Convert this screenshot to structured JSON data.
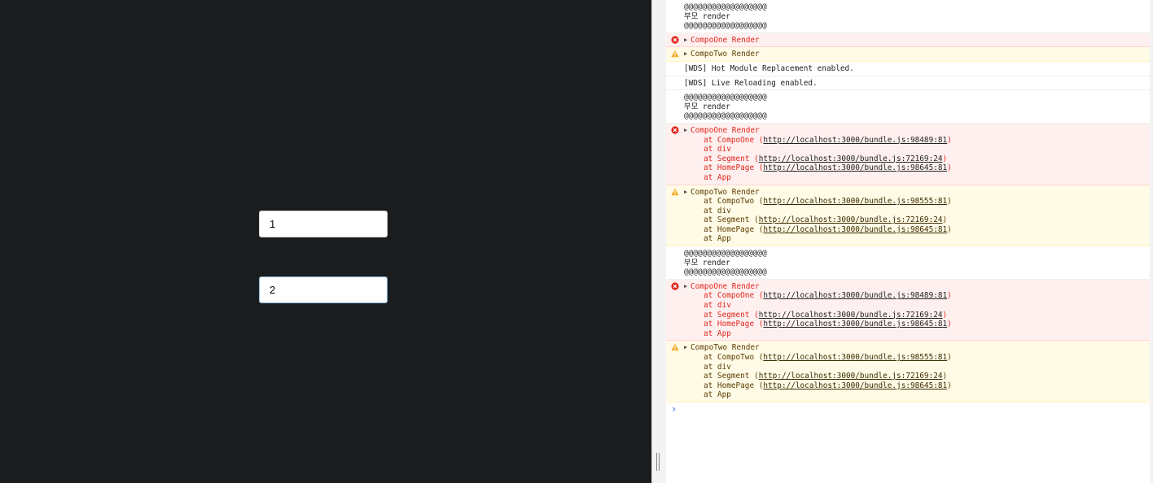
{
  "app": {
    "input1_value": "1",
    "input2_value": "2"
  },
  "console": {
    "rows": [
      {
        "kind": "log",
        "lines": [
          "@@@@@@@@@@@@@@@@@@",
          "부모 render",
          "@@@@@@@@@@@@@@@@@@"
        ]
      },
      {
        "kind": "error",
        "head": "CompoOne Render"
      },
      {
        "kind": "warn",
        "head": "CompoTwo Render"
      },
      {
        "kind": "log",
        "lines": [
          "[WDS] Hot Module Replacement enabled."
        ]
      },
      {
        "kind": "log",
        "lines": [
          "[WDS] Live Reloading enabled."
        ]
      },
      {
        "kind": "log",
        "lines": [
          "@@@@@@@@@@@@@@@@@@",
          "부모 render",
          "@@@@@@@@@@@@@@@@@@"
        ]
      },
      {
        "kind": "error",
        "head": "CompoOne Render",
        "stack": [
          {
            "pre": "at CompoOne (",
            "link": "http://localhost:3000/bundle.js:98489:81",
            "post": ")"
          },
          {
            "pre": "at div",
            "link": "",
            "post": ""
          },
          {
            "pre": "at Segment (",
            "link": "http://localhost:3000/bundle.js:72169:24",
            "post": ")"
          },
          {
            "pre": "at HomePage (",
            "link": "http://localhost:3000/bundle.js:98645:81",
            "post": ")"
          },
          {
            "pre": "at App",
            "link": "",
            "post": ""
          }
        ]
      },
      {
        "kind": "warn",
        "head": "CompoTwo Render",
        "stack": [
          {
            "pre": "at CompoTwo (",
            "link": "http://localhost:3000/bundle.js:98555:81",
            "post": ")"
          },
          {
            "pre": "at div",
            "link": "",
            "post": ""
          },
          {
            "pre": "at Segment (",
            "link": "http://localhost:3000/bundle.js:72169:24",
            "post": ")"
          },
          {
            "pre": "at HomePage (",
            "link": "http://localhost:3000/bundle.js:98645:81",
            "post": ")"
          },
          {
            "pre": "at App",
            "link": "",
            "post": ""
          }
        ]
      },
      {
        "kind": "log",
        "lines": [
          "@@@@@@@@@@@@@@@@@@",
          "부모 render",
          "@@@@@@@@@@@@@@@@@@"
        ]
      },
      {
        "kind": "error",
        "head": "CompoOne Render",
        "stack": [
          {
            "pre": "at CompoOne (",
            "link": "http://localhost:3000/bundle.js:98489:81",
            "post": ")"
          },
          {
            "pre": "at div",
            "link": "",
            "post": ""
          },
          {
            "pre": "at Segment (",
            "link": "http://localhost:3000/bundle.js:72169:24",
            "post": ")"
          },
          {
            "pre": "at HomePage (",
            "link": "http://localhost:3000/bundle.js:98645:81",
            "post": ")"
          },
          {
            "pre": "at App",
            "link": "",
            "post": ""
          }
        ]
      },
      {
        "kind": "warn",
        "head": "CompoTwo Render",
        "stack": [
          {
            "pre": "at CompoTwo (",
            "link": "http://localhost:3000/bundle.js:98555:81",
            "post": ")"
          },
          {
            "pre": "at div",
            "link": "",
            "post": ""
          },
          {
            "pre": "at Segment (",
            "link": "http://localhost:3000/bundle.js:72169:24",
            "post": ")"
          },
          {
            "pre": "at HomePage (",
            "link": "http://localhost:3000/bundle.js:98645:81",
            "post": ")"
          },
          {
            "pre": "at App",
            "link": "",
            "post": ""
          }
        ]
      }
    ],
    "prompt_symbol": "›",
    "colors": {
      "error_bg": "#fff0f0",
      "warn_bg": "#fffbe6",
      "error_text": "#e0261c",
      "warn_icon": "#f2ab26",
      "error_icon": "#e0261c"
    }
  }
}
